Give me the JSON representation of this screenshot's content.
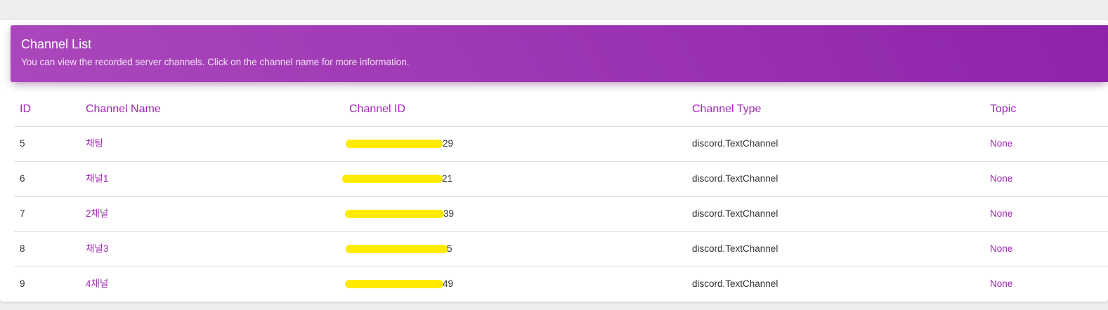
{
  "header": {
    "title": "Channel List",
    "subtitle": "You can view the recorded server channels. Click on the channel name for more information."
  },
  "columns": {
    "id": "ID",
    "name": "Channel Name",
    "channel_id": "Channel ID",
    "type": "Channel Type",
    "topic": "Topic"
  },
  "rows": [
    {
      "id": "5",
      "name": "채팅",
      "channel_id_visible": "29",
      "type": "discord.TextChannel",
      "topic": "None"
    },
    {
      "id": "6",
      "name": "채널1",
      "channel_id_visible": "21",
      "type": "discord.TextChannel",
      "topic": "None"
    },
    {
      "id": "7",
      "name": "2채널",
      "channel_id_visible": "39",
      "type": "discord.TextChannel",
      "topic": "None"
    },
    {
      "id": "8",
      "name": "채널3",
      "channel_id_visible": "5",
      "type": "discord.TextChannel",
      "topic": "None"
    },
    {
      "id": "9",
      "name": "4채널",
      "channel_id_visible": "49",
      "type": "discord.TextChannel",
      "topic": "None"
    }
  ],
  "colors": {
    "accent": "#9c27b0",
    "header_start": "#ab47bc",
    "header_end": "#8e24aa",
    "redaction": "#ffeb00"
  }
}
